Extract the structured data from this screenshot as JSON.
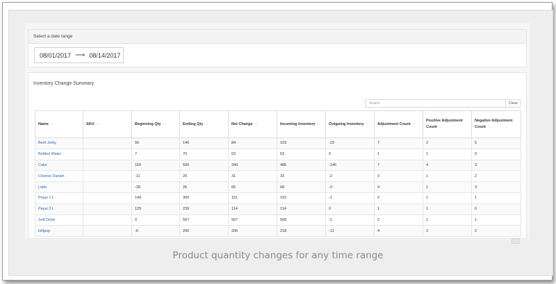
{
  "date_range": {
    "header": "Select a date range",
    "start": "08/01/2017",
    "arrow": "⟶",
    "end": "08/14/2017"
  },
  "summary": {
    "title": "Inventory Change Summary",
    "search_placeholder": "Search",
    "clear_label": "Clear",
    "sort_icon": "↑↓",
    "columns": [
      "Name",
      "SKU",
      "Beginning Qty",
      "Ending Qty",
      "Net Change",
      "Incoming Inventory",
      "Outgoing Inventory",
      "Adjustment Count",
      "Positive Adjustment Count",
      "Negative Adjustment Count"
    ],
    "rows": [
      [
        "Beef Jerky",
        "",
        "56",
        "140",
        "84",
        "103",
        "-19",
        "7",
        "2",
        "5"
      ],
      [
        "Bottled Water",
        "",
        "7",
        "70",
        "63",
        "63",
        "0",
        "1",
        "1",
        "0"
      ],
      [
        "Cake",
        "",
        "160",
        "500",
        "340",
        "486",
        "-146",
        "7",
        "4",
        "3"
      ],
      [
        "Cheese Danish",
        "",
        "-11",
        "20",
        "31",
        "33",
        "-2",
        "3",
        "1",
        "2"
      ],
      [
        "Latte",
        "",
        "-39",
        "26",
        "65",
        "68",
        "-3",
        "4",
        "1",
        "3"
      ],
      [
        "Pepsi 1 L",
        "",
        "149",
        "300",
        "151",
        "152",
        "-1",
        "2",
        "1",
        "1"
      ],
      [
        "Pepsi 2 L",
        "",
        "125",
        "239",
        "114",
        "114",
        "0",
        "1",
        "1",
        "0"
      ],
      [
        "Soft Drink",
        "",
        "0",
        "567",
        "567",
        "568",
        "-1",
        "2",
        "1",
        "1"
      ],
      [
        "lollipop",
        "",
        "-6",
        "200",
        "206",
        "218",
        "-12",
        "4",
        "2",
        "2"
      ]
    ]
  },
  "caption": "Product quantity changes for any time range",
  "colors": {
    "link": "#2a62b3",
    "caption": "#8a8a8a"
  }
}
